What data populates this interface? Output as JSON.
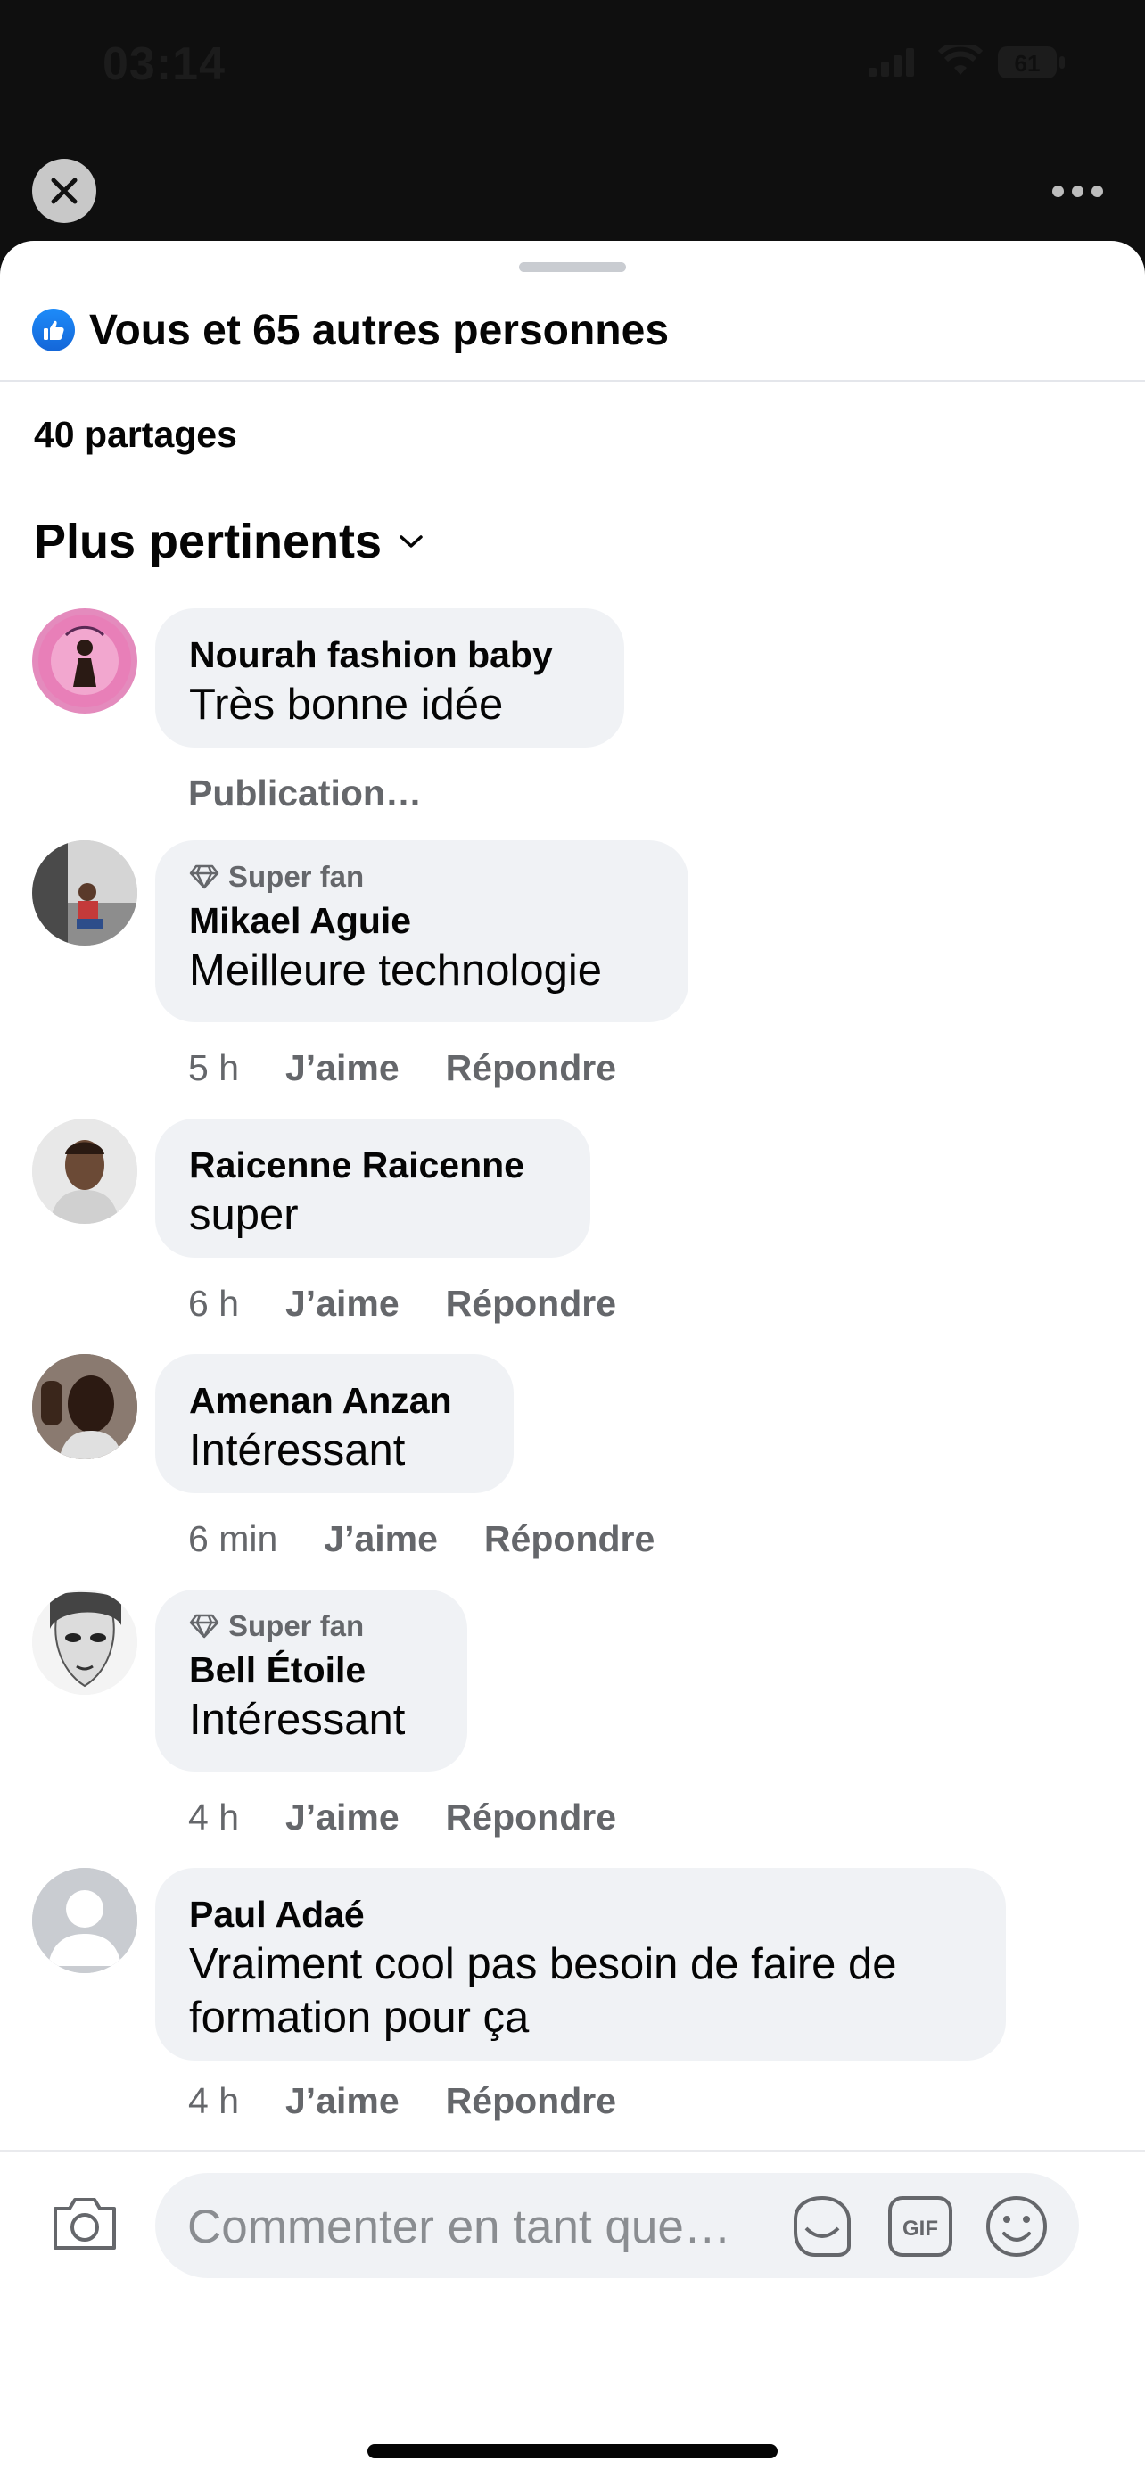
{
  "status_bar": {
    "time": "03:14",
    "battery": "61"
  },
  "sheet": {
    "reactions_label": "Vous et 65 autres personnes",
    "shares_label": "40 partages",
    "sort_label": "Plus pertinents"
  },
  "comments": [
    {
      "name": "Nourah fashion baby",
      "text": "Très bonne idée",
      "badge": "",
      "time": "",
      "status": "Publication…",
      "like": "",
      "reply": ""
    },
    {
      "name": "Mikael Aguie",
      "text": "Meilleure technologie",
      "badge": "Super fan",
      "time": "5 h",
      "like": "J’aime",
      "reply": "Répondre"
    },
    {
      "name": "Raicenne Raicenne",
      "text": "super",
      "badge": "",
      "time": "6 h",
      "like": "J’aime",
      "reply": "Répondre"
    },
    {
      "name": "Amenan Anzan",
      "text": "Intéressant",
      "badge": "",
      "time": "6 min",
      "like": "J’aime",
      "reply": "Répondre"
    },
    {
      "name": "Bell Étoile",
      "text": "Intéressant",
      "badge": "Super fan",
      "time": "4 h",
      "like": "J’aime",
      "reply": "Répondre"
    },
    {
      "name": "Paul Adaé",
      "text_line1": "Vraiment cool pas besoin de faire de",
      "text_line2": "formation pour ça",
      "badge": "",
      "time": "4 h",
      "like": "J’aime",
      "reply": "Répondre"
    }
  ],
  "composer": {
    "placeholder": "Commenter en tant que…",
    "gif_label": "GIF"
  },
  "icons": [
    "close-icon",
    "more-icon",
    "like-icon",
    "chevron-down-icon",
    "diamond-icon",
    "camera-icon",
    "sticker-icon",
    "gif-icon",
    "emoji-icon"
  ],
  "colors": {
    "like_blue": "#1877f2",
    "bubble_bg": "#f0f2f5",
    "secondary_text": "#65676b"
  }
}
